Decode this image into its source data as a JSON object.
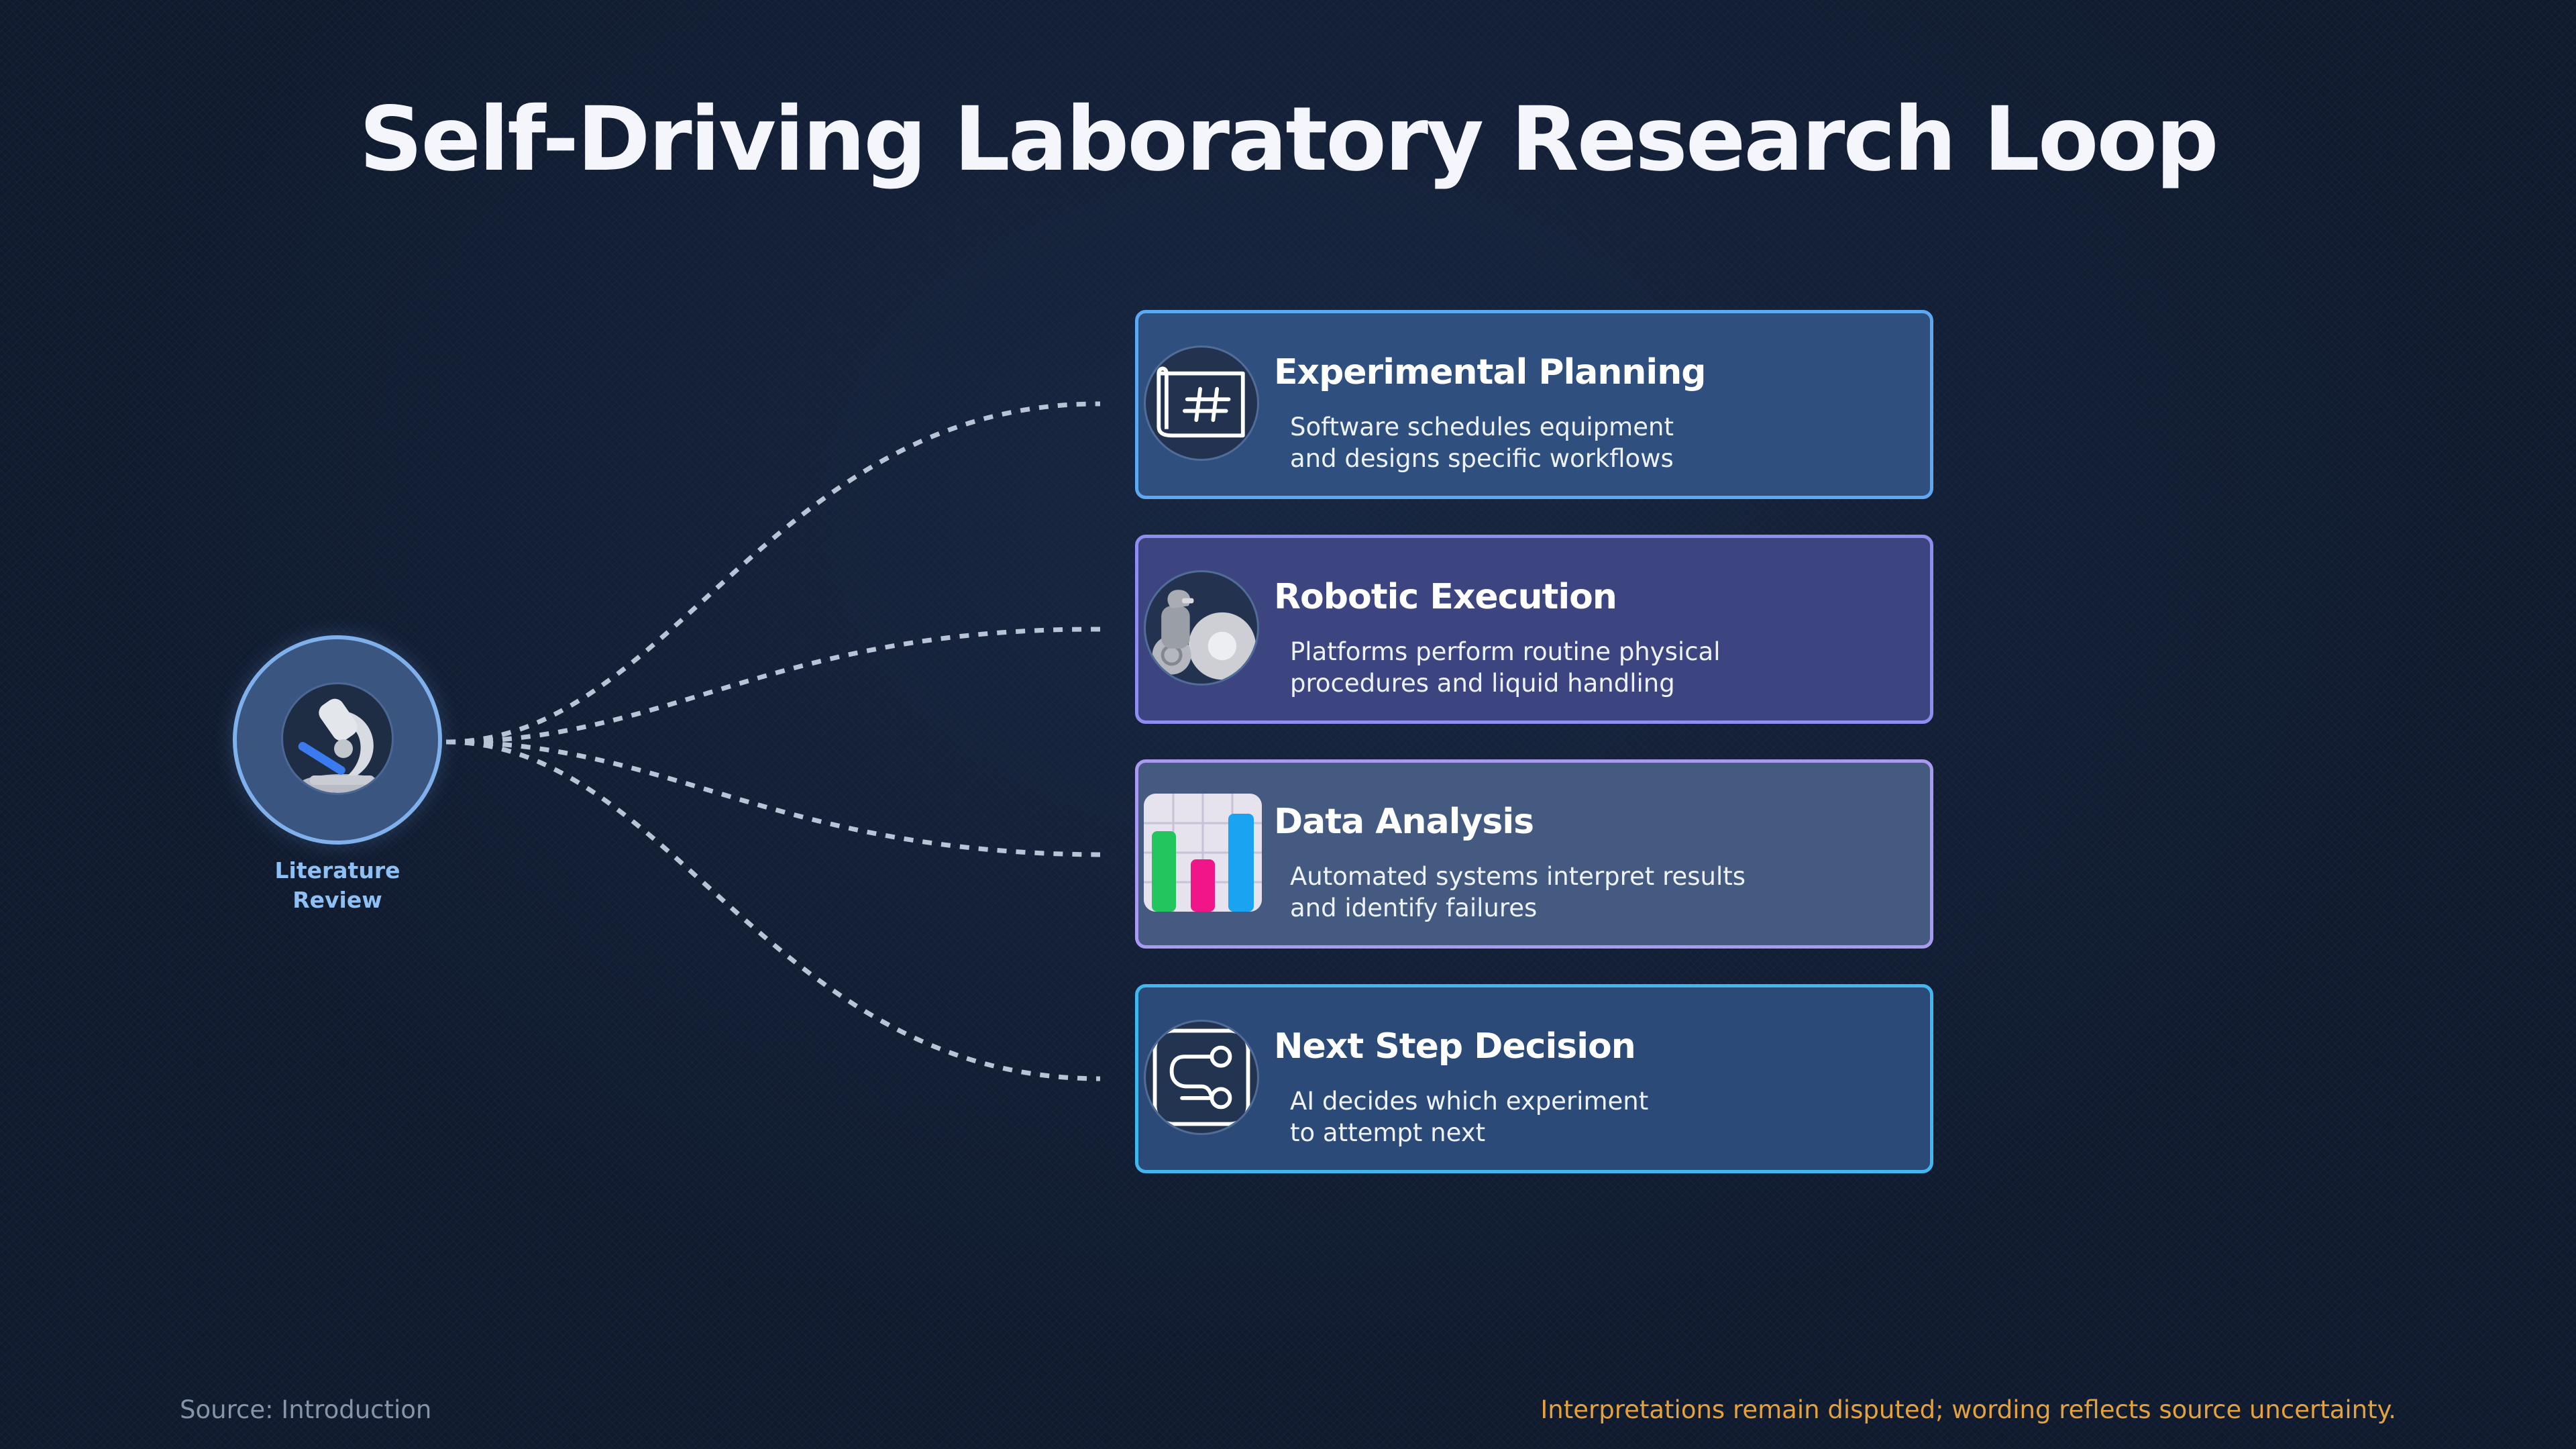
{
  "title": "Self-Driving Laboratory Research Loop",
  "hub": {
    "label_line1": "Literature",
    "label_line2": "Review",
    "icon": "microscope-icon"
  },
  "steps": [
    {
      "title": "Experimental Planning",
      "desc_line1": "Software schedules equipment",
      "desc_line2": "and designs specific workflows",
      "icon": "blueprint-icon"
    },
    {
      "title": "Robotic Execution",
      "desc_line1": "Platforms perform routine physical",
      "desc_line2": "procedures and liquid handling",
      "icon": "robot-arm-icon"
    },
    {
      "title": "Data Analysis",
      "desc_line1": "Automated systems interpret results",
      "desc_line2": "and identify failures",
      "icon": "bar-chart-icon"
    },
    {
      "title": "Next Step Decision",
      "desc_line1": "AI decides which experiment",
      "desc_line2": "to attempt next",
      "icon": "decision-path-icon"
    }
  ],
  "colors": {
    "background": "#0f1a2e",
    "connector": "#b8c4d6",
    "hub_border": "#7fb0ec",
    "hub_label": "#8fc0f5",
    "footer_note": "#e6a23a"
  },
  "footer": {
    "source": "Source: Introduction",
    "note": "Interpretations remain disputed; wording reflects source uncertainty."
  }
}
